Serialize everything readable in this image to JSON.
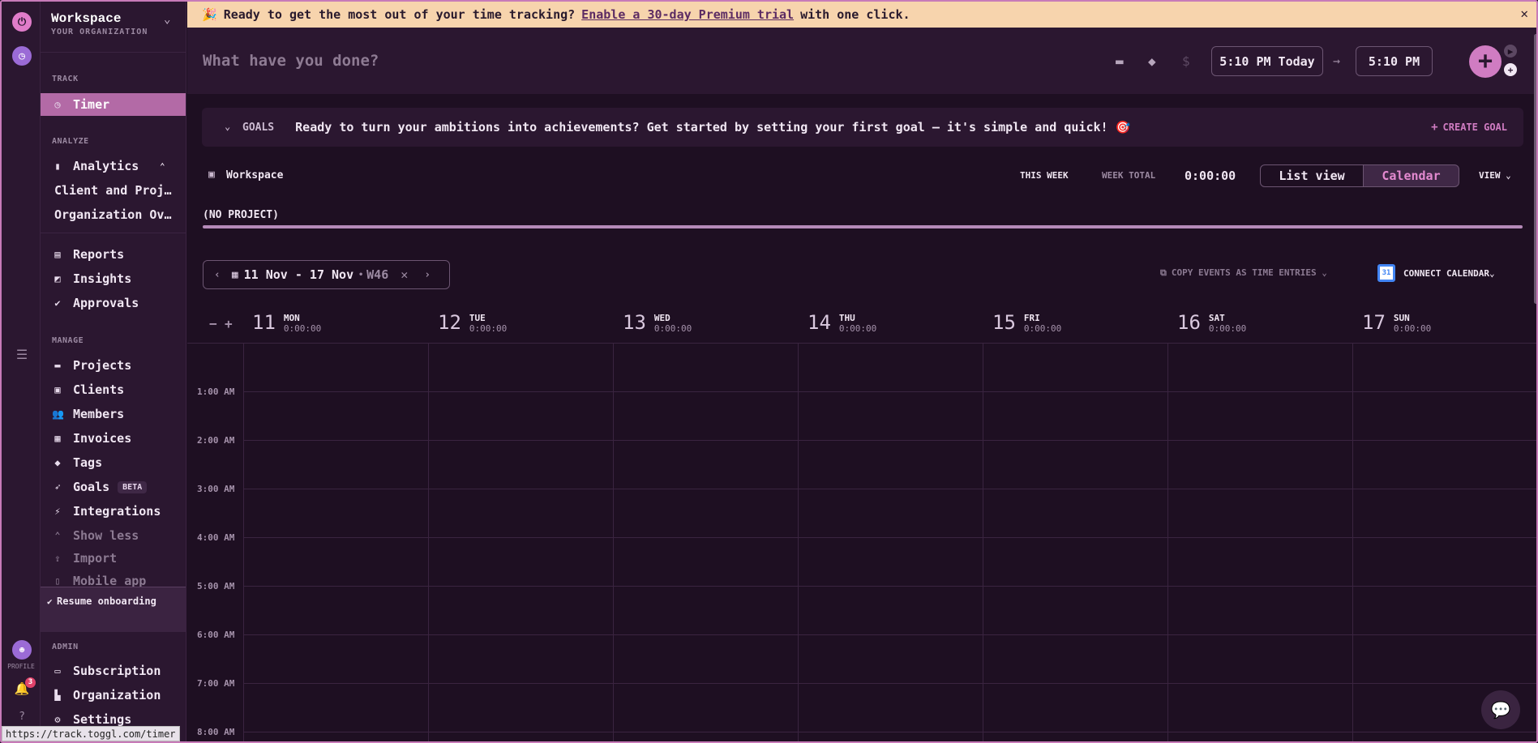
{
  "rail": {
    "profile_label": "PROFILE",
    "notification_count": "3"
  },
  "sidebar": {
    "workspace_name": "Workspace",
    "workspace_sub": "YOUR ORGANIZATION",
    "track_header": "TRACK",
    "timer": "Timer",
    "analyze_header": "ANALYZE",
    "analytics": "Analytics",
    "client_projects": "Client and Proj…",
    "org_overview": "Organization Ov…",
    "reports": "Reports",
    "insights": "Insights",
    "approvals": "Approvals",
    "manage_header": "MANAGE",
    "projects": "Projects",
    "clients": "Clients",
    "members": "Members",
    "invoices": "Invoices",
    "tags": "Tags",
    "goals": "Goals",
    "goals_badge": "BETA",
    "integrations": "Integrations",
    "show_less": "Show less",
    "import": "Import",
    "mobile_app": "Mobile app",
    "resume_onboarding": "Resume onboarding",
    "admin_header": "ADMIN",
    "subscription": "Subscription",
    "organization": "Organization",
    "settings": "Settings"
  },
  "banner": {
    "text_before": "Ready to get the most out of your time tracking?",
    "link": "Enable a 30-day Premium trial",
    "text_after": "with one click."
  },
  "timer": {
    "placeholder": "What have you done?",
    "start_time": "5:10 PM Today",
    "end_time": "5:10 PM"
  },
  "goals": {
    "label": "GOALS",
    "message": "Ready to turn your ambitions into achievements? Get started by setting your first goal — it's simple and quick! 🎯",
    "create": "CREATE GOAL"
  },
  "summary": {
    "workspace": "Workspace",
    "period": "THIS WEEK",
    "week_total_label": "WEEK TOTAL",
    "week_total": "0:00:00",
    "list_view": "List view",
    "calendar": "Calendar",
    "view": "VIEW"
  },
  "project_bar": {
    "label": "(NO PROJECT)"
  },
  "range": {
    "dates": "11 Nov - 17 Nov",
    "week": "W46"
  },
  "calendar_actions": {
    "copy": "COPY EVENTS AS TIME ENTRIES",
    "connect": "CONNECT CALENDAR"
  },
  "days": [
    {
      "num": "11",
      "name": "MON",
      "time": "0:00:00"
    },
    {
      "num": "12",
      "name": "TUE",
      "time": "0:00:00"
    },
    {
      "num": "13",
      "name": "WED",
      "time": "0:00:00"
    },
    {
      "num": "14",
      "name": "THU",
      "time": "0:00:00"
    },
    {
      "num": "15",
      "name": "FRI",
      "time": "0:00:00"
    },
    {
      "num": "16",
      "name": "SAT",
      "time": "0:00:00"
    },
    {
      "num": "17",
      "name": "SUN",
      "time": "0:00:00"
    }
  ],
  "hours": [
    "1:00 AM",
    "2:00 AM",
    "3:00 AM",
    "4:00 AM",
    "5:00 AM",
    "6:00 AM",
    "7:00 AM",
    "8:00 AM"
  ],
  "status_url": "https://track.toggl.com/timer"
}
